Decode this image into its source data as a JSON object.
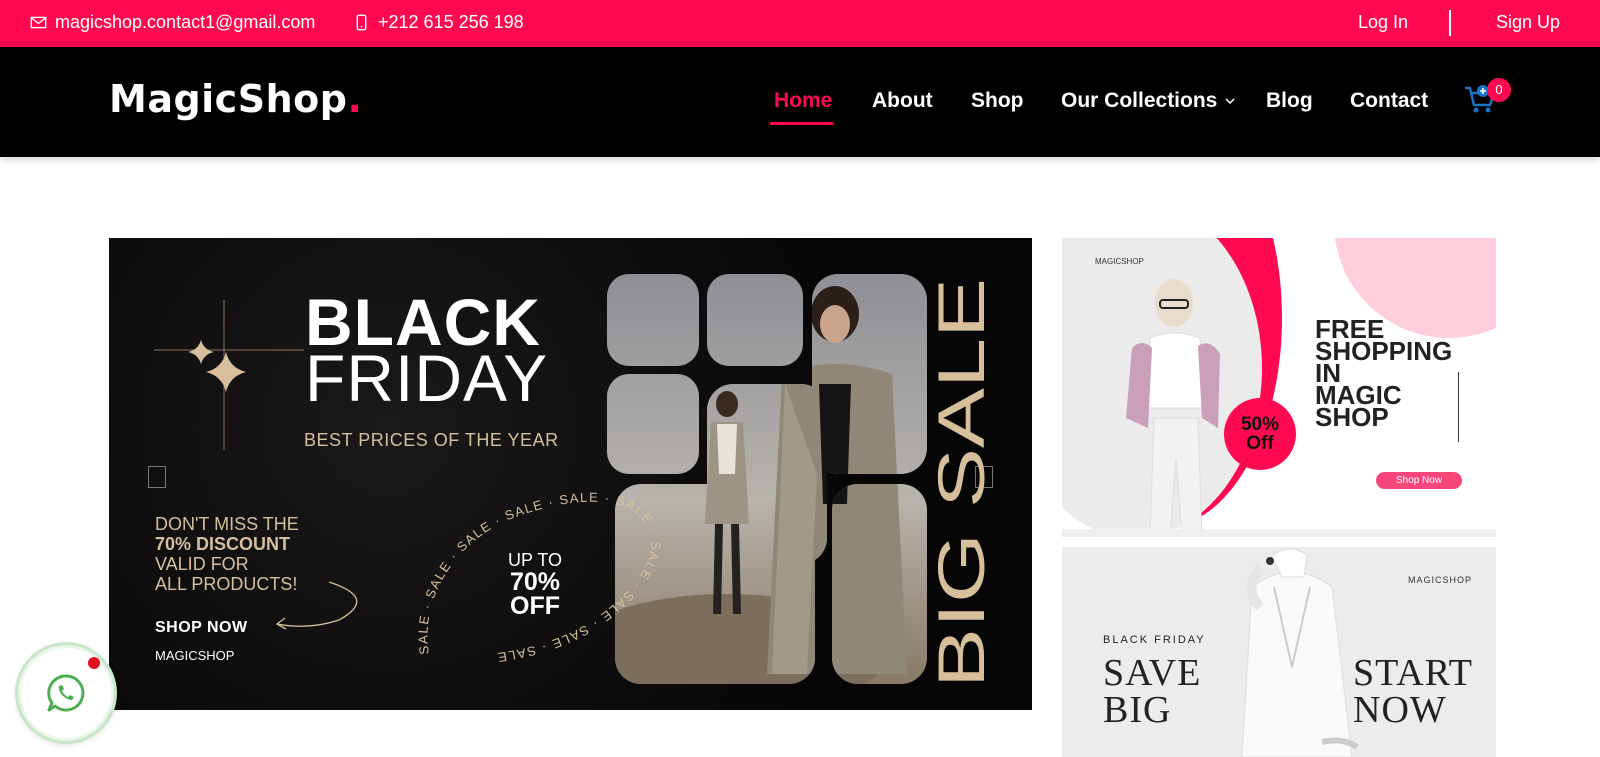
{
  "topbar": {
    "email": "magicshop.contact1@gmail.com",
    "phone": "+212 615 256 198",
    "login": "Log In",
    "signup": "Sign Up"
  },
  "header": {
    "logo": "MagicShop",
    "logo_dot": ".",
    "nav": [
      "Home",
      "About",
      "Shop",
      "Our Collections",
      "Blog",
      "Contact"
    ],
    "active_nav": "Home",
    "cart_count": "0"
  },
  "banner": {
    "title_line1": "BLACK",
    "title_line2": "FRIDAY",
    "subtitle": "BEST PRICES OF THE YEAR",
    "miss_line1": "DON'T MISS THE",
    "miss_line2": "70% DISCOUNT",
    "miss_line3": "VALID FOR",
    "miss_line4": "ALL PRODUCTS!",
    "shop_now": "SHOP NOW",
    "brand": "MAGICSHOP",
    "upto": "UP TO",
    "upto_pct": "70%",
    "upto_off": "OFF",
    "vertical": "BIG SALE",
    "ring_text": "SALE · SALE · SALE · SALE · SALE · SALE · SALE · SALE · SALE · SALE"
  },
  "promo1": {
    "brand": "MAGICSHOP",
    "headline": [
      "FREE",
      "SHOPPING",
      "IN",
      "MAGIC",
      "SHOP"
    ],
    "badge_pct": "50%",
    "badge_off": "Off",
    "button": "Shop Now"
  },
  "promo2": {
    "brand": "MAGICSHOP",
    "tag": "BLACK FRIDAY",
    "left_line1": "SAVE",
    "left_line2": "BIG",
    "right_line1": "START",
    "right_line2": "NOW"
  },
  "colors": {
    "accent": "#ff0a50",
    "header_bg": "#000000",
    "beige": "#d8bf9c"
  }
}
